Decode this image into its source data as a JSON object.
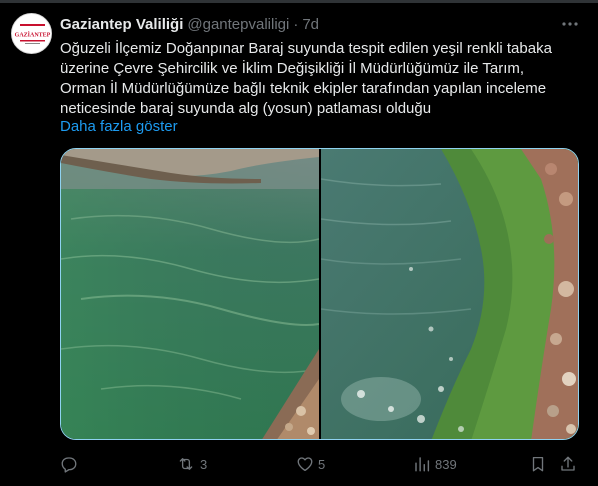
{
  "tweet": {
    "author_name": "Gaziantep Valiliği",
    "handle": "@gantepvaliligi",
    "separator": "·",
    "time": "7d",
    "avatar_text": "GAZİANTEP",
    "body_lines": [
      "Oğuzeli İlçemiz Doğanpınar Baraj suyunda tespit edilen yeşil renkli tabaka",
      "üzerine Çevre Şehircilik ve İklim Değişikliği İl Müdürlüğümüz ile Tarım,",
      "Orman İl Müdürlüğümüze bağlı teknik ekipler tarafından yapılan inceleme",
      "neticesinde baraj suyunda alg (yosun) patlaması olduğu"
    ],
    "show_more": "Daha fazla göster",
    "media": [
      {
        "description_icon": "photo-green-water-shore"
      },
      {
        "description_icon": "photo-algae-rocky-shore"
      }
    ]
  },
  "actions": {
    "reply_count": "",
    "retweet_count": "3",
    "like_count": "5",
    "views_count": "839"
  },
  "colors": {
    "background": "#000000",
    "text": "#e7e9ea",
    "muted": "#71767b",
    "link": "#1d9bf0",
    "media_border": "#8fd2f0"
  }
}
